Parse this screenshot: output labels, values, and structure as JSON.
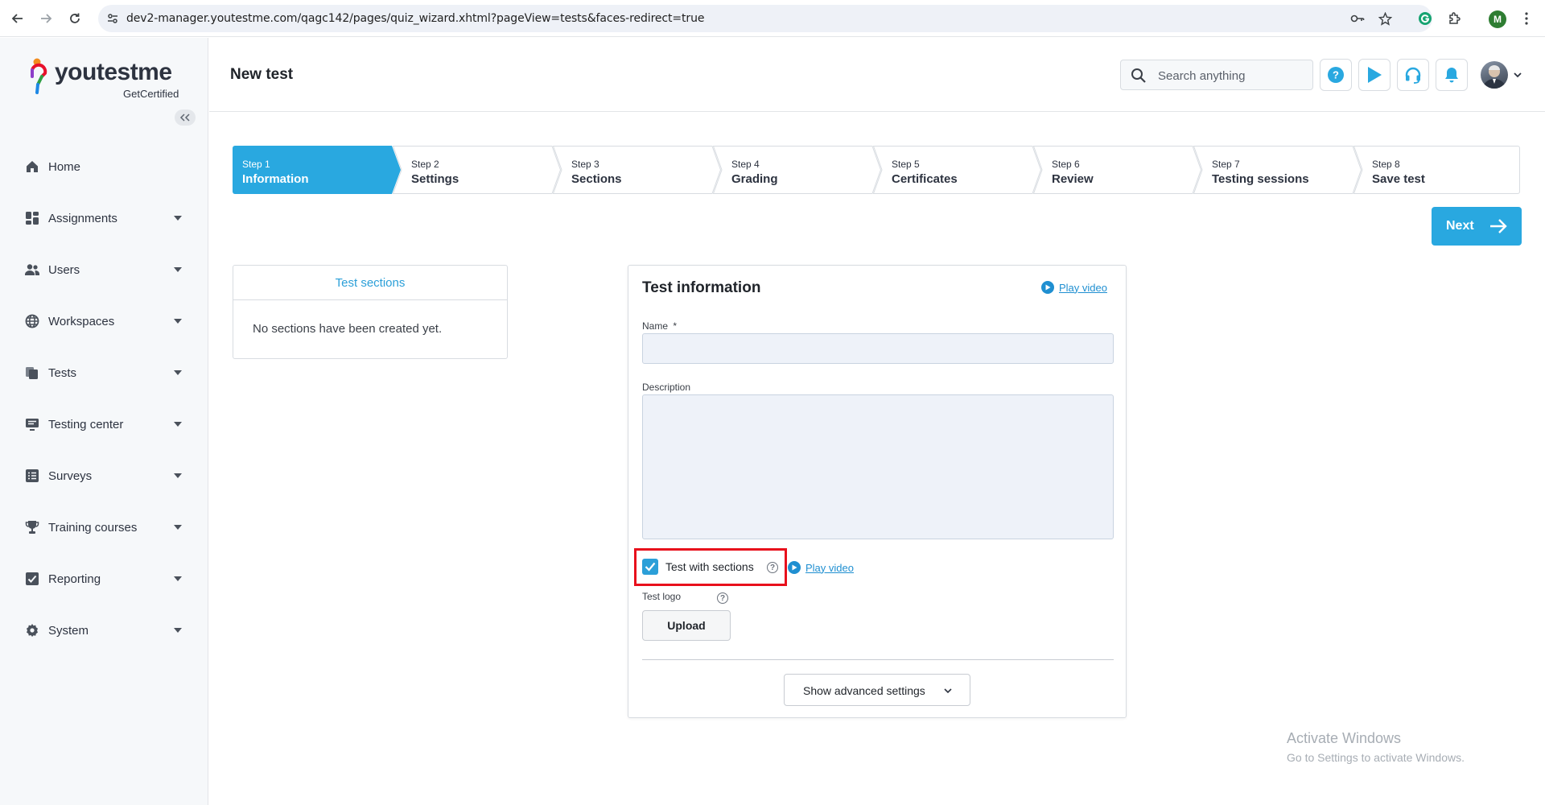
{
  "browser": {
    "url": "dev2-manager.youtestme.com/qagc142/pages/quiz_wizard.xhtml?pageView=tests&faces-redirect=true",
    "profile_initial": "M"
  },
  "sidebar": {
    "logo_text": "youtestme",
    "logo_subtext": "GetCertified",
    "items": [
      {
        "label": "Home",
        "icon": "home-icon",
        "has_caret": false
      },
      {
        "label": "Assignments",
        "icon": "dashboard-icon",
        "has_caret": true
      },
      {
        "label": "Users",
        "icon": "users-icon",
        "has_caret": true
      },
      {
        "label": "Workspaces",
        "icon": "globe-icon",
        "has_caret": true
      },
      {
        "label": "Tests",
        "icon": "tests-icon",
        "has_caret": true
      },
      {
        "label": "Testing center",
        "icon": "monitor-icon",
        "has_caret": true
      },
      {
        "label": "Surveys",
        "icon": "survey-list-icon",
        "has_caret": true
      },
      {
        "label": "Training courses",
        "icon": "trophy-icon",
        "has_caret": true
      },
      {
        "label": "Reporting",
        "icon": "report-check-icon",
        "has_caret": true
      },
      {
        "label": "System",
        "icon": "gear-icon",
        "has_caret": true
      }
    ]
  },
  "header": {
    "title": "New test",
    "search_placeholder": "Search anything"
  },
  "stepper": {
    "active_index": 0,
    "steps": [
      {
        "num": "Step 1",
        "title": "Information"
      },
      {
        "num": "Step 2",
        "title": "Settings"
      },
      {
        "num": "Step 3",
        "title": "Sections"
      },
      {
        "num": "Step 4",
        "title": "Grading"
      },
      {
        "num": "Step 5",
        "title": "Certificates"
      },
      {
        "num": "Step 6",
        "title": "Review"
      },
      {
        "num": "Step 7",
        "title": "Testing sessions"
      },
      {
        "num": "Step 8",
        "title": "Save test"
      }
    ],
    "next_label": "Next"
  },
  "sections_panel": {
    "title": "Test sections",
    "empty_text": "No sections have been created yet."
  },
  "info_card": {
    "title": "Test information",
    "play_video_label": "Play video",
    "name_label": "Name",
    "name_required_mark": "*",
    "name_value": "",
    "description_label": "Description",
    "description_value": "",
    "test_with_sections_label": "Test with sections",
    "test_with_sections_checked": true,
    "test_with_sections_play_video": "Play video",
    "test_logo_label": "Test logo",
    "upload_label": "Upload",
    "advanced_settings_label": "Show advanced settings"
  },
  "watermark": {
    "title": "Activate Windows",
    "subtitle": "Go to Settings to activate Windows."
  },
  "colors": {
    "accent": "#29a8e0",
    "highlight": "#e8101c"
  }
}
